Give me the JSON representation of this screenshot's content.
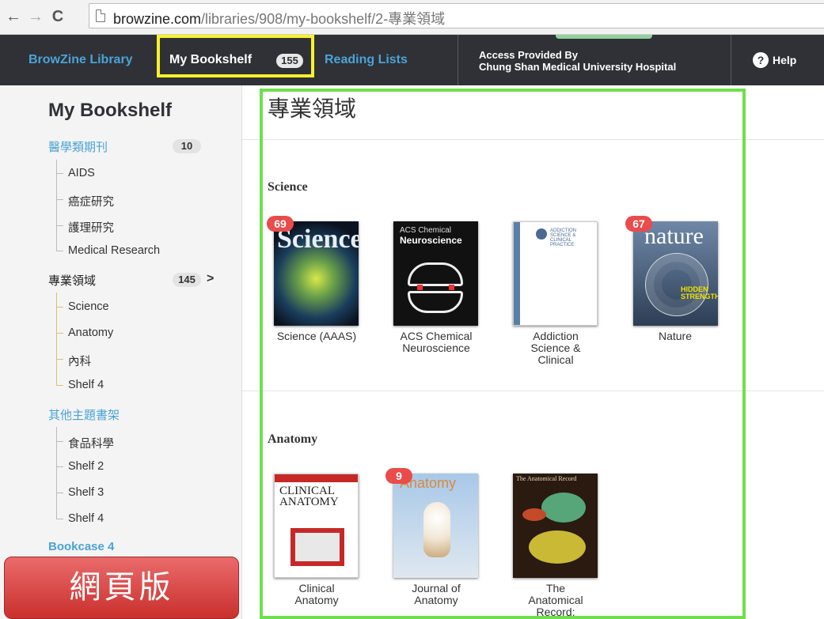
{
  "browser": {
    "url_domain": "browzine.com",
    "url_path": "/libraries/908/my-bookshelf/2-專業領域"
  },
  "topbar": {
    "library_label": "BrowZine Library",
    "bookshelf_label": "My Bookshelf",
    "bookshelf_count": "155",
    "reading_lists_label": "Reading Lists",
    "access_line1": "Access Provided By",
    "access_line2": "Chung Shan Medical University Hospital",
    "help_label": "Help"
  },
  "sidebar": {
    "title": "My Bookshelf",
    "groups": [
      {
        "label": "醫學類期刊",
        "count": "10",
        "items": [
          "AIDS",
          "癌症研究",
          "護理研究",
          "Medical Research"
        ]
      },
      {
        "label": "專業領域",
        "count": "145",
        "items": [
          "Science",
          "Anatomy",
          "內科",
          "Shelf 4"
        ]
      },
      {
        "label": "其他主題書架",
        "count": "",
        "items": [
          "食品科學",
          "Shelf 2",
          "Shelf 3",
          "Shelf 4"
        ]
      }
    ],
    "bookcase_label": "Bookcase 4"
  },
  "overlay_label": "網頁版",
  "main": {
    "title": "專業領域",
    "sections": [
      {
        "heading": "Science",
        "journals": [
          {
            "label": "Science (AAAS)",
            "count": "69",
            "cover_text": "Science"
          },
          {
            "label": "ACS Chemical Neuroscience",
            "count": "",
            "cover_text": "Neuroscience",
            "cover_sub": "ACS Chemical"
          },
          {
            "label": "Addiction Science & Clinical",
            "count": "",
            "cover_text": "ADDICTION SCIENCE & CLINICAL PRACTICE"
          },
          {
            "label": "Nature",
            "count": "67",
            "cover_text": "nature",
            "cover_sub": "HIDDEN STRENGTH"
          }
        ]
      },
      {
        "heading": "Anatomy",
        "journals": [
          {
            "label": "Clinical Anatomy",
            "count": "",
            "cover_text": "CLINICAL ANATOMY"
          },
          {
            "label": "Journal of Anatomy",
            "count": "9",
            "cover_text": "Anatomy"
          },
          {
            "label": "The Anatomical Record:",
            "count": "",
            "cover_text": "The Anatomical Record"
          }
        ]
      }
    ]
  }
}
